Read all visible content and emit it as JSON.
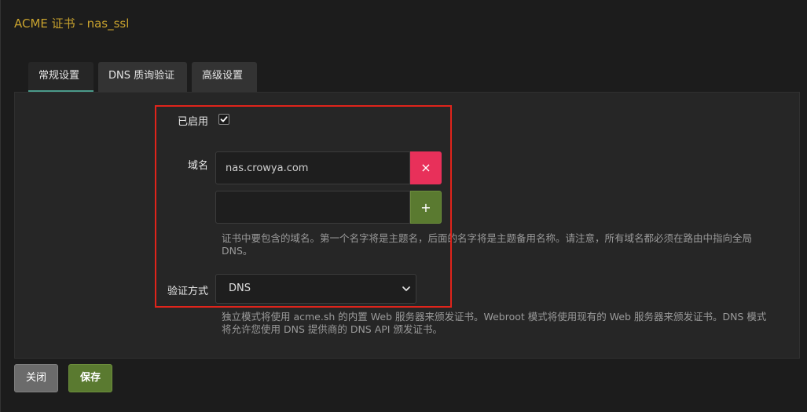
{
  "dialog": {
    "title": "ACME 证书 - nas_ssl"
  },
  "tabs": [
    {
      "label": "常规设置",
      "active": true
    },
    {
      "label": "DNS 质询验证",
      "active": false
    },
    {
      "label": "高级设置",
      "active": false
    }
  ],
  "form": {
    "enabled": {
      "label": "已启用",
      "checked": true
    },
    "domains": {
      "label": "域名",
      "values": [
        "nas.crowya.com",
        ""
      ],
      "remove_label": "×",
      "add_label": "+",
      "help_line1": "证书中要包含的域名。第一个名字将是主题名，后面的名字将是主题备用名称。请注意，所有域名都必须在路由中指向全局",
      "help_line2": "DNS。"
    },
    "validation": {
      "label": "验证方式",
      "selected": "DNS",
      "help_line1": "独立模式将使用 acme.sh 的内置 Web 服务器来颁发证书。Webroot 模式将使用现有的 Web 服务器来颁发证书。DNS 模式",
      "help_line2": "将允许您使用 DNS 提供商的 DNS API 颁发证书。"
    }
  },
  "footer": {
    "close_label": "关闭",
    "save_label": "保存"
  },
  "colors": {
    "title": "#c8a22e",
    "highlight_border": "#e0241b",
    "remove_button": "#e8305a",
    "add_button": "#5a7a30",
    "active_tab_underline": "#4a9a8a"
  }
}
